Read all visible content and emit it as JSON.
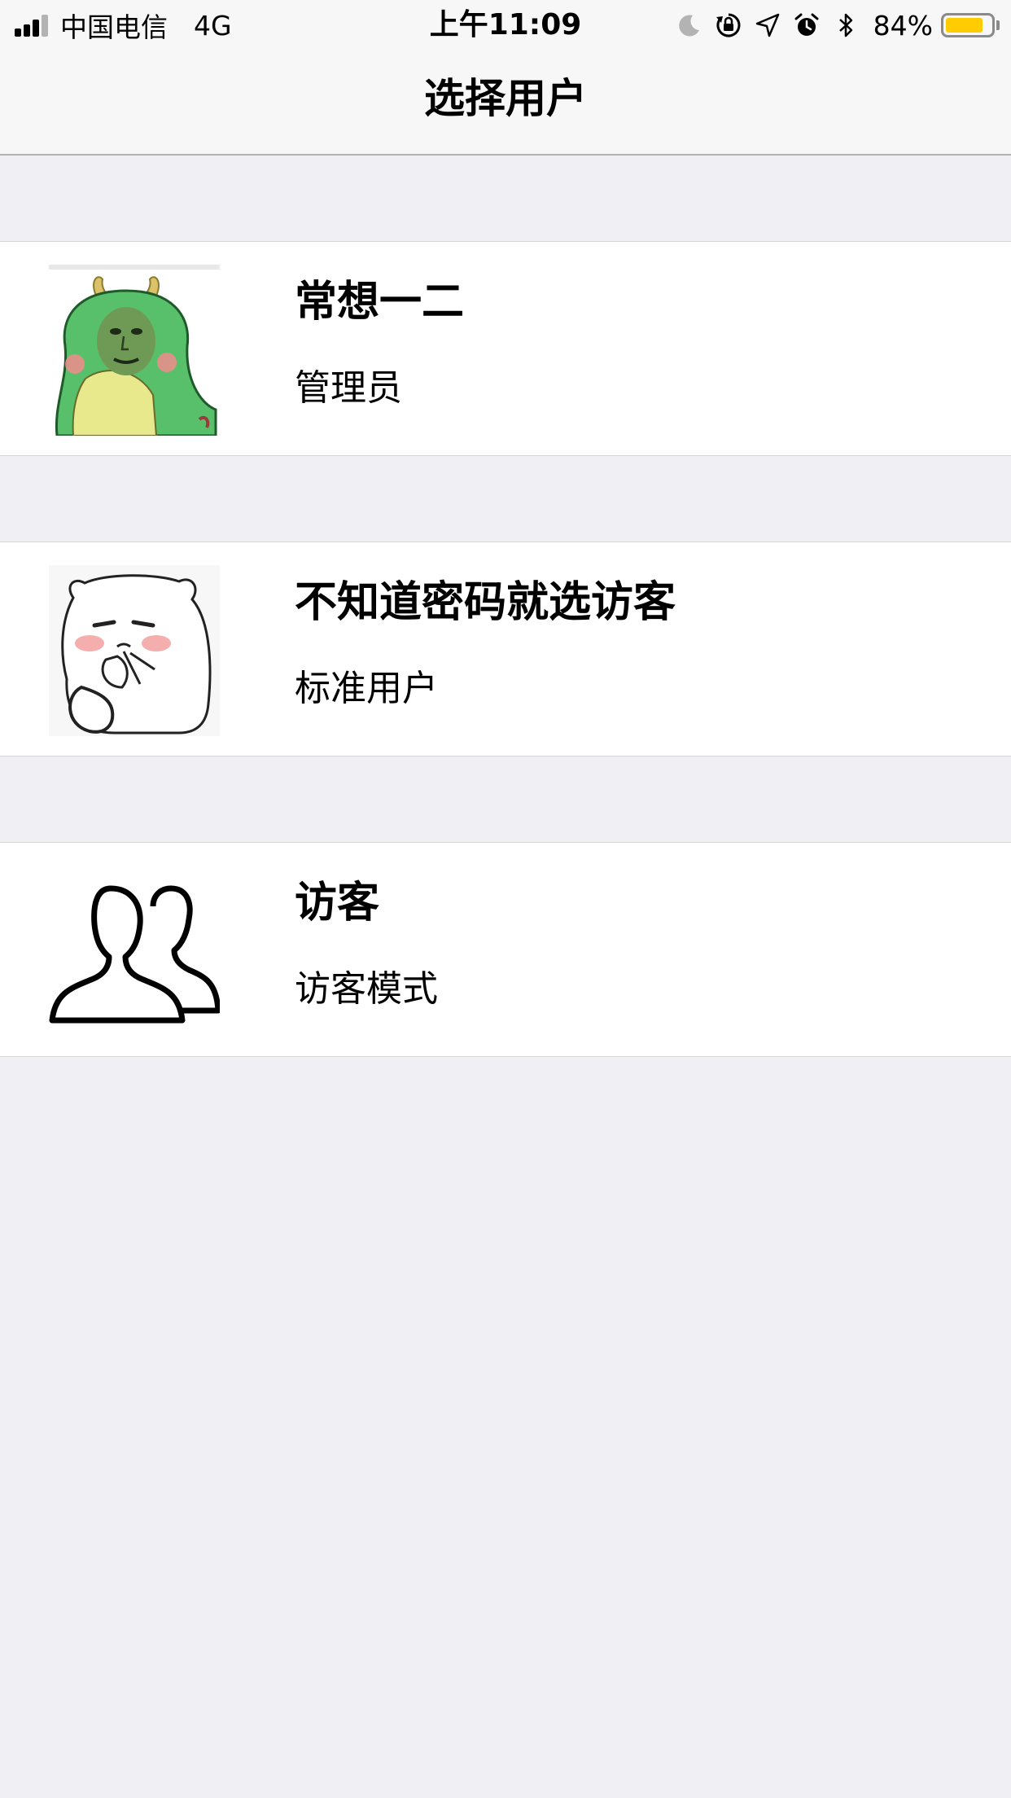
{
  "status_bar": {
    "carrier": "中国电信",
    "network": "4G",
    "time": "上午11:09",
    "battery_percent": "84%",
    "battery_level": 0.84,
    "icons": [
      "signal-icon",
      "moon-icon",
      "rotation-lock-icon",
      "location-icon",
      "alarm-icon",
      "bluetooth-icon",
      "battery-icon"
    ]
  },
  "nav": {
    "title": "选择用户"
  },
  "users": [
    {
      "name": "常想一二",
      "role": "管理员",
      "avatar": "green-dinosaur-meme-avatar"
    },
    {
      "name": "不知道密码就选访客",
      "role": "标准用户",
      "avatar": "bear-meme-avatar"
    },
    {
      "name": "访客",
      "role": "访客模式",
      "avatar": "guest-users-icon"
    }
  ],
  "colors": {
    "background": "#efeff4",
    "bar_background": "#f7f7f7",
    "battery": "#ffcc00",
    "row_background": "#ffffff"
  }
}
